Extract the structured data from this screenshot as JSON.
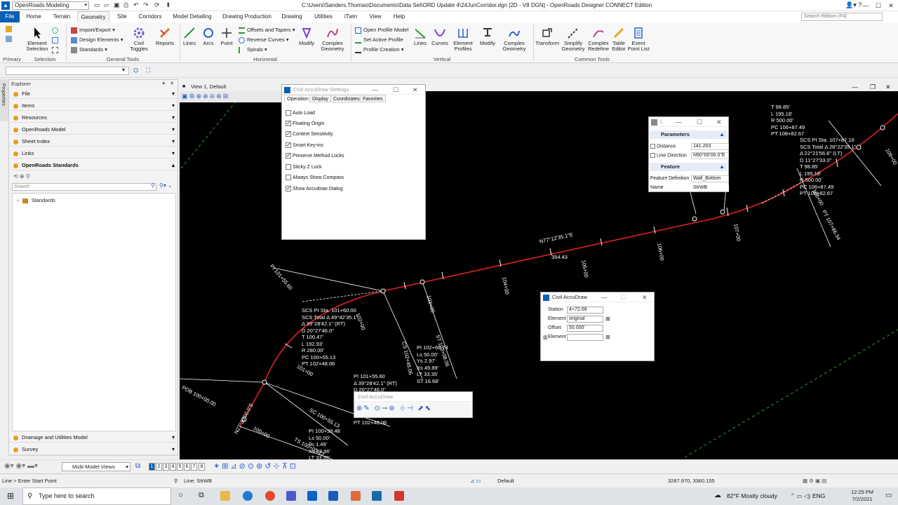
{
  "app": {
    "workspace": "OpenRoads Modeling",
    "window_title": "C:\\Users\\Sanders.Thomas\\Documents\\Data Set\\ORD Update 4\\24JunCorridor.dgn [2D - V8 DGN] - OpenRoads Designer CONNECT Edition"
  },
  "ribbon_tabs": [
    "File",
    "Home",
    "Terrain",
    "Geometry",
    "Site",
    "Corridors",
    "Model Detailing",
    "Drawing Production",
    "Drawing",
    "Utilities",
    "iTwin",
    "View",
    "Help"
  ],
  "ribbon_search_placeholder": "Search Ribbon (F4)",
  "ribbon": {
    "element_selection": "Element Selection",
    "import_export": "Import/Export",
    "design_elements": "Design Elements",
    "standards": "Standards",
    "civil_toggles": "Civil Toggles",
    "reports": "Reports",
    "lines": "Lines",
    "arcs": "Arcs",
    "point": "Point",
    "offsets_tapers": "Offsets and Tapers",
    "reverse_curves": "Reverse Curves",
    "spirals": "Spirals",
    "modify": "Modify",
    "complex_geometry": "Complex Geometry",
    "open_profile_model": "Open Profile Model",
    "set_active_profile": "Set Active Profile",
    "profile_creation": "Profile Creation",
    "v_lines": "Lines",
    "v_curves": "Curves",
    "element_profiles": "Element Profiles",
    "v_modify": "Modify",
    "v_complex_geometry": "Complex Geometry",
    "transform": "Transform",
    "simplify_geometry": "Simplify Geometry",
    "complex_redefine": "Complex Redefine",
    "table_editor": "Table Editor",
    "event_point_list": "Event Point List",
    "groups": {
      "primary": "Primary",
      "selection": "Selection",
      "general_tools": "General Tools",
      "horizontal": "Horizontal",
      "vertical": "Vertical",
      "common_tools": "Common Tools"
    }
  },
  "explorer": {
    "title": "Explorer",
    "properties_tab": "Properties",
    "sections": [
      "File",
      "Items",
      "Resources",
      "OpenRoads Model",
      "Sheet Index",
      "Links",
      "OpenRoads Standards"
    ],
    "search_placeholder": "Search",
    "tree_root": "Standards",
    "bottom_sections": [
      "Drainage and Utilities Model",
      "Survey"
    ]
  },
  "view": {
    "title": "View 1, Default"
  },
  "cad_labels": {
    "top_right_curve": "T 98.85'\nL 195.18'\nR 500.00'\nPC 106+87.49\nPT 108+82.67",
    "top_right_scs": "SCS PI Sta. 107+87.16\nSCS Total Δ 28°22'35.1\"\nΔ 22°21'56.6\" (LT)\nD 11°27'33.0\"\nT 98.85'\nL 195.18'\nR 500.00'\nPC 106+87.49\nPT 108+82.67",
    "sta_109": "109+00",
    "sta_108": "108+00",
    "sta_107": "107+00",
    "sta_106": "106+00",
    "sta_105": "105+00",
    "sta_104": "104+00",
    "sta_103": "103+00",
    "sta_102": "102+00",
    "sta_101": "101+00",
    "sta_100": "100+00",
    "pt_107_86": "PT 107+86.34",
    "bearing": "N77°12'35.1\"E",
    "distance": "354.43",
    "pi_101_55": "PI 101+55.60",
    "scs_block": "SCS PI Sta. 101+60.00\nSCS Total Δ 49°42'35.1\"\nΔ 39°28'42.1\" (RT)\nD 20°27'46.0\"\nT 100.47'\nL 192.93'\nR 280.00'\nPC 100+55.13\nPT 102+48.06",
    "pi_block_mid": "PI 101+55.60\nΔ 39°28'42.1\" (RT)\nD 20°27'46.0\"",
    "pt_102_48": "PT 102+48.06",
    "cs_label": "CS 102+48.06",
    "st_label": "ST 103+08.06",
    "pi_102_block": "PI 102+68.74\nLs 50.00'\nYs 2.97'\nXs 49.89'\nLT 33.35'\nST 16.68'",
    "pob": "POB 100+00.00",
    "sc_label": "SC 100+55.13",
    "ts_label": "TS 100+05.13",
    "pi_100_block": "PI 100+38.48\nLs 50.00'\nθs 1.49'\nXs 49.96'\nLT 33.35'",
    "n27": "N27°30'00.0\"E",
    "sta_100_small": "100+00"
  },
  "settings_dialog": {
    "title": "Civil AccuDraw Settings",
    "tabs": [
      "Operation",
      "Display",
      "Coordinates",
      "Favorites"
    ],
    "options": [
      {
        "label": "Auto Load",
        "checked": false
      },
      {
        "label": "Floating Origin",
        "checked": true
      },
      {
        "label": "Context Sensitivity",
        "checked": true
      },
      {
        "label": "Smart Key-ins",
        "checked": true
      },
      {
        "label": "Preserve Method Locks",
        "checked": true
      },
      {
        "label": "Sticky Z Lock",
        "checked": false
      },
      {
        "label": "Always Show Compass",
        "checked": false
      },
      {
        "label": "Show Accudraw Dialog",
        "checked": true
      }
    ]
  },
  "line_dialog": {
    "title": "L",
    "parameters": "Parameters",
    "distance_label": "Distance",
    "distance_value": "141.203",
    "line_direction_label": "Line Direction",
    "line_direction_value": "N90°00'00.0\"E",
    "feature": "Feature",
    "feature_definition_label": "Feature Definition",
    "feature_definition_value": "Wall_Bottom",
    "name_label": "Name",
    "name_value": "StrWB"
  },
  "accudraw_dialog": {
    "title": "Civil AccuDraw",
    "station_label": "Station",
    "station_value": "4+72.68",
    "element_label": "Element",
    "element_value": "original",
    "offset_label": "Offset",
    "offset_value": "50.000'",
    "element2_label": "Element",
    "element2_value": ""
  },
  "accudraw_toolbar": {
    "title": "Civil AccuDraw"
  },
  "bottom_toolbar": {
    "views_label": "Multi-Model Views",
    "view_numbers": [
      "1",
      "2",
      "3",
      "4",
      "5",
      "6",
      "7",
      "8"
    ]
  },
  "status": {
    "prompt": "Line > Enter Start Point",
    "active": "Line: StrWB",
    "level": "Default",
    "coords": "3287.970, 3360.155"
  },
  "taskbar": {
    "search_placeholder": "Type here to search",
    "weather": "82°F  Mostly cloudy",
    "lang": "ENG",
    "time": "12:25 PM",
    "date": "7/2/2021"
  }
}
